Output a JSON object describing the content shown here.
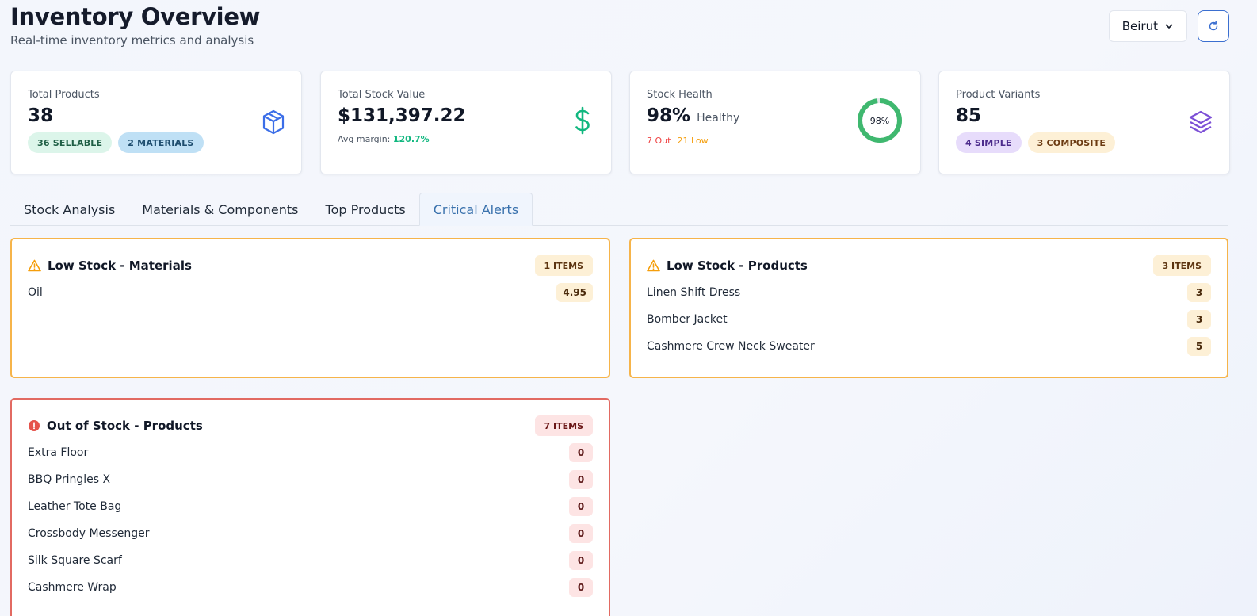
{
  "header": {
    "title": "Inventory Overview",
    "subtitle": "Real-time inventory metrics and analysis",
    "location": "Beirut"
  },
  "cards": {
    "total_products": {
      "label": "Total Products",
      "value": "38",
      "badges": [
        "36 SELLABLE",
        "2 MATERIALS"
      ]
    },
    "stock_value": {
      "label": "Total Stock Value",
      "value": "$131,397.22",
      "margin_label": "Avg margin:",
      "margin_value": "120.7%"
    },
    "stock_health": {
      "label": "Stock Health",
      "value": "98%",
      "status": "Healthy",
      "out": "7 Out",
      "low": "21 Low",
      "ring_label": "98%",
      "ring_percent": 98
    },
    "variants": {
      "label": "Product Variants",
      "value": "85",
      "badges": [
        "4 SIMPLE",
        "3 COMPOSITE"
      ]
    }
  },
  "tabs": [
    "Stock Analysis",
    "Materials & Components",
    "Top Products",
    "Critical Alerts"
  ],
  "active_tab": "Critical Alerts",
  "alerts": {
    "low_materials": {
      "title": "Low Stock - Materials",
      "count": "1 ITEMS",
      "items": [
        {
          "name": "Oil",
          "qty": "4.95"
        }
      ]
    },
    "low_products": {
      "title": "Low Stock - Products",
      "count": "3 ITEMS",
      "items": [
        {
          "name": "Linen Shift Dress",
          "qty": "3"
        },
        {
          "name": "Bomber Jacket",
          "qty": "3"
        },
        {
          "name": "Cashmere Crew Neck Sweater",
          "qty": "5"
        }
      ]
    },
    "out_products": {
      "title": "Out of Stock - Products",
      "count": "7 ITEMS",
      "items": [
        {
          "name": "Extra Floor",
          "qty": "0"
        },
        {
          "name": "BBQ Pringles X",
          "qty": "0"
        },
        {
          "name": "Leather Tote Bag",
          "qty": "0"
        },
        {
          "name": "Crossbody Messenger",
          "qty": "0"
        },
        {
          "name": "Silk Square Scarf",
          "qty": "0"
        },
        {
          "name": "Cashmere Wrap",
          "qty": "0"
        }
      ]
    }
  },
  "colors": {
    "accent_blue": "#3b6fd0",
    "healthy_green": "#3fb86f",
    "warning_amber": "#f6b44a",
    "danger_red": "#e26a62",
    "variants_purple": "#7c4fd6"
  }
}
